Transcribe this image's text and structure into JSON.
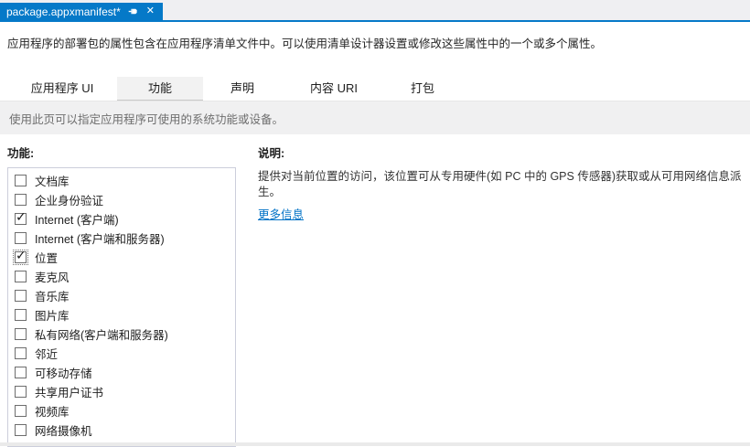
{
  "document_tab": {
    "title": "package.appxmanifest*"
  },
  "intro_text": "应用程序的部署包的属性包含在应用程序清单文件中。可以使用清单设计器设置或修改这些属性中的一个或多个属性。",
  "nav_tabs": [
    {
      "label": "应用程序 UI",
      "selected": false
    },
    {
      "label": "功能",
      "selected": true
    },
    {
      "label": "声明",
      "selected": false
    },
    {
      "label": "内容 URI",
      "selected": false
    },
    {
      "label": "打包",
      "selected": false
    }
  ],
  "tab_hint": "使用此页可以指定应用程序可使用的系统功能或设备。",
  "capabilities": {
    "label": "功能:",
    "items": [
      {
        "label": "文档库",
        "checked": false,
        "focused": false
      },
      {
        "label": "企业身份验证",
        "checked": false,
        "focused": false
      },
      {
        "label": "Internet (客户端)",
        "checked": true,
        "focused": false
      },
      {
        "label": "Internet (客户端和服务器)",
        "checked": false,
        "focused": false
      },
      {
        "label": "位置",
        "checked": true,
        "focused": true
      },
      {
        "label": "麦克风",
        "checked": false,
        "focused": false
      },
      {
        "label": "音乐库",
        "checked": false,
        "focused": false
      },
      {
        "label": "图片库",
        "checked": false,
        "focused": false
      },
      {
        "label": "私有网络(客户端和服务器)",
        "checked": false,
        "focused": false
      },
      {
        "label": "邻近",
        "checked": false,
        "focused": false
      },
      {
        "label": "可移动存储",
        "checked": false,
        "focused": false
      },
      {
        "label": "共享用户证书",
        "checked": false,
        "focused": false
      },
      {
        "label": "视频库",
        "checked": false,
        "focused": false
      },
      {
        "label": "网络摄像机",
        "checked": false,
        "focused": false
      }
    ]
  },
  "description": {
    "label": "说明:",
    "text": "提供对当前位置的访问，该位置可从专用硬件(如 PC 中的 GPS 传感器)获取或从可用网络信息派生。",
    "link_label": "更多信息"
  },
  "colors": {
    "accent_blue": "#0579c8",
    "link_blue": "#0072c6",
    "check_mark": "✓"
  }
}
